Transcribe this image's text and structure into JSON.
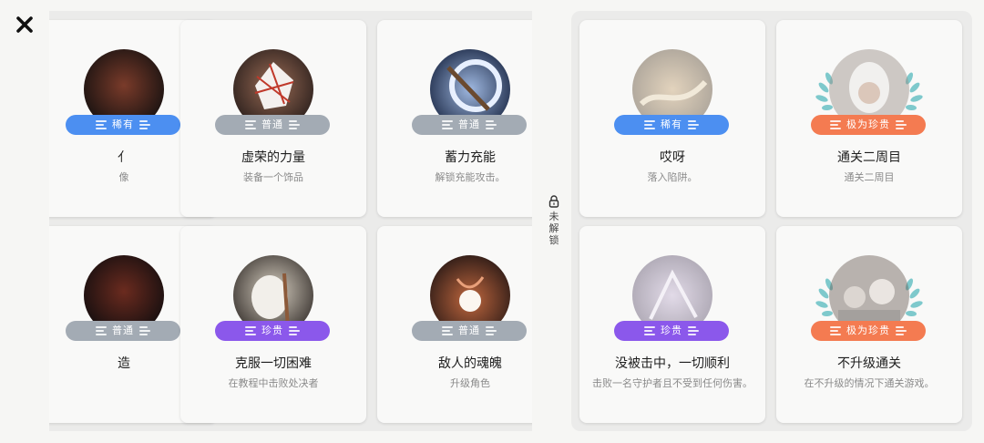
{
  "window": {
    "close_icon": "close-icon"
  },
  "lock": {
    "label_chars": [
      "未",
      "解",
      "锁"
    ],
    "icon": "lock-icon"
  },
  "badges": {
    "common": "普通",
    "rare": "稀有",
    "precious": "珍贵",
    "legendary": "极为珍贵"
  },
  "colors": {
    "common": "#a3abb4",
    "rare": "#4c8ff1",
    "precious": "#8b58eb",
    "legendary": "#f47b51"
  },
  "cards_left": [
    {
      "title": "亻",
      "desc": "像",
      "rarity": "稀有"
    },
    {
      "title": "虚荣的力量",
      "desc": "装备一个饰品",
      "rarity": "普通"
    },
    {
      "title": "蓄力充能",
      "desc": "解锁充能攻击。",
      "rarity": "普通"
    },
    {
      "title": "造",
      "desc": "",
      "rarity": "普通"
    },
    {
      "title": "克服一切困难",
      "desc": "在教程中击败处决者",
      "rarity": "珍贵"
    },
    {
      "title": "敌人的魂魄",
      "desc": "升级角色",
      "rarity": "普通"
    }
  ],
  "cards_right": [
    {
      "title": "哎呀",
      "desc": "落入陷阱。",
      "rarity": "稀有"
    },
    {
      "title": "通关二周目",
      "desc": "通关二周目",
      "rarity": "极为珍贵"
    },
    {
      "title": "没被击中，一切顺利",
      "desc": "击败一名守护者且不受到任何伤害。",
      "rarity": "珍贵"
    },
    {
      "title": "不升级通关",
      "desc": "在不升级的情况下通关游戏。",
      "rarity": "极为珍贵"
    }
  ]
}
